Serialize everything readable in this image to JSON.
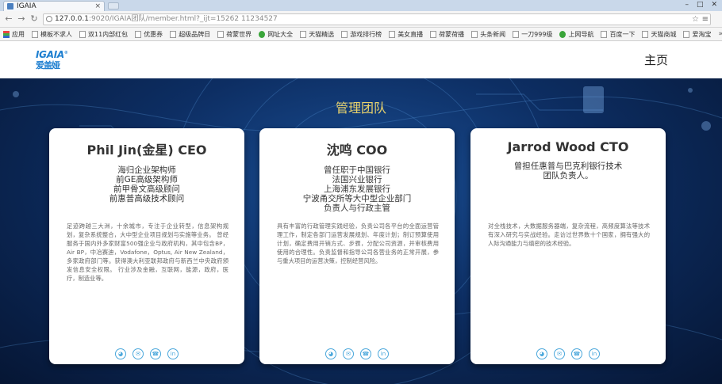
{
  "browser": {
    "tab_title": "IGAIA",
    "url_host": "127.0.0.1",
    "url_rest": ":9020/IGAIA团队/member.html?_ijt=15262 11234527",
    "bookmarks": [
      "应用",
      "模板不求人",
      "双11内部红包",
      "优惠券",
      "超级品牌日",
      "荷蒙世界",
      "网址大全",
      "天猫精选",
      "游戏排行榜",
      "美女直播",
      "荷蒙荷播",
      "头条新闻",
      "一刀999级",
      "上网导航",
      "百度一下",
      "天猫商城",
      "爱淘宝"
    ]
  },
  "site": {
    "logo_text": "IGAIA",
    "logo_cn": "爱盖娅",
    "nav_home": "主页",
    "section_title": "管理团队"
  },
  "team": [
    {
      "name": "Phil Jin(金星) CEO",
      "roles": [
        "海归企业架构师",
        "前GE高级架构师",
        "前甲骨文高级顾问",
        "前惠普高级技术顾问"
      ],
      "bio": "足迹跨越三大洲，十余城市，专注于企业转型，信息架构规划，复杂系统整合，大中型企业项目规划与实施等业务。 曾经服务于国内外多家财富500强企业与政府机构，其中包含BP，Air BP，中冶赛迪，Vodafone，Optus, Air New Zealand，多家政府部门等。获得澳大利亚联邦政府与新西兰中央政府颁发信息安全权限。 行业涉及金融，互联网，能源，政府，医疗，制造业等。"
    },
    {
      "name": "沈鸣 COO",
      "roles": [
        "曾任职于中国银行",
        "法国兴业银行",
        "上海浦东发展银行",
        "宁波甬交所等大中型企业部门",
        "负责人与行政主管"
      ],
      "bio": "具有丰富的行政管理实践经验，负责公司各平台的全面运营管理工作，制定各部门运营发展规划、年度计划；制订预算使用计划，确定费用开销方式、步骤，分配公司资源，并审核费用使用的合理性。负责监督和指导公司各营业务的正常开展，参与重大项目的运营决策，控制经营风险。"
    },
    {
      "name": "Jarrod Wood CTO",
      "roles": [
        "曾担任惠普与巴克利银行技术",
        "团队负责人。"
      ],
      "bio": "对全栈技术，大数据服务器端，复杂流程，高频度算法等技术有深入研究与实战经验。走访过世界数十个国家，拥有强大的人际沟通能力与缜密的技术经验。"
    }
  ],
  "social_icons": [
    "wechat-icon",
    "email-icon",
    "phone-icon",
    "linkedin-icon"
  ],
  "colors": {
    "title_gold": "#e8d26c",
    "logo_blue": "#1e7fd0",
    "icon_blue": "#4aa7db",
    "hero_dark": "#0d2e63"
  }
}
